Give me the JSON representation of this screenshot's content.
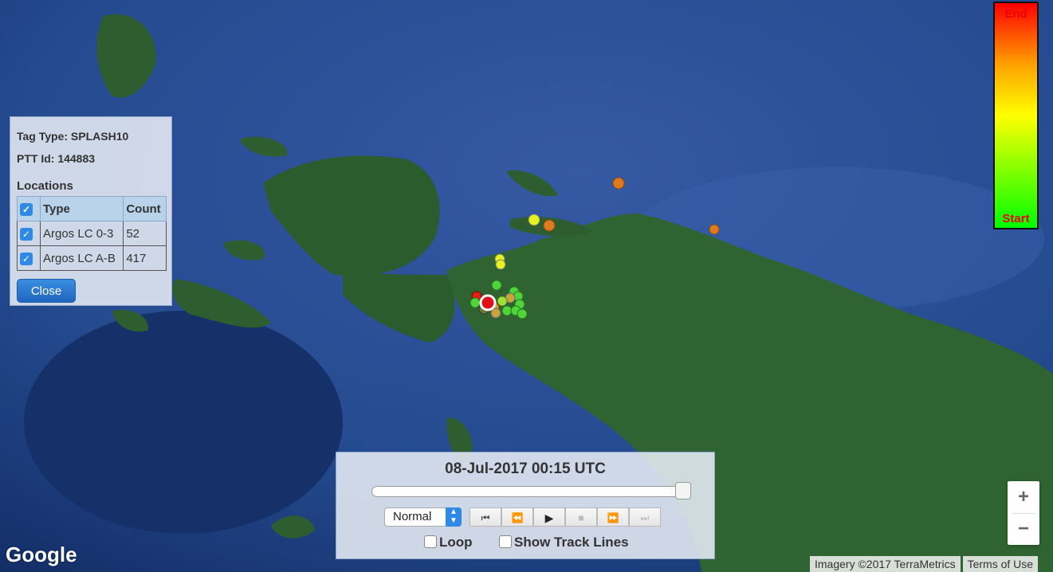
{
  "info": {
    "tag_type": "Tag Type: SPLASH10",
    "ptt_id": "PTT Id: 144883",
    "locations_title": "Locations",
    "headers": [
      "Type",
      "Count"
    ],
    "rows": [
      {
        "type": "Argos LC 0-3",
        "count": "52"
      },
      {
        "type": "Argos LC A-B",
        "count": "417"
      }
    ],
    "close_label": "Close"
  },
  "legend": {
    "end": "End",
    "start": "Start",
    "colors": [
      "#ff0000",
      "#ffa500",
      "#ffff00",
      "#00ff00"
    ]
  },
  "playback": {
    "date": "08-Jul-2017 00:15 UTC",
    "speed": "Normal",
    "progress": 1.0,
    "loop_label": "Loop",
    "track_label": "Show Track Lines",
    "controls": [
      "⏮",
      "⏪",
      "▶",
      "■",
      "⏩",
      "⏭"
    ]
  },
  "zoom": {
    "in": "+",
    "out": "−"
  },
  "google_logo": "Google",
  "attribution": {
    "imagery": "Imagery ©2017 TerraMetrics",
    "terms": "Terms of Use"
  }
}
